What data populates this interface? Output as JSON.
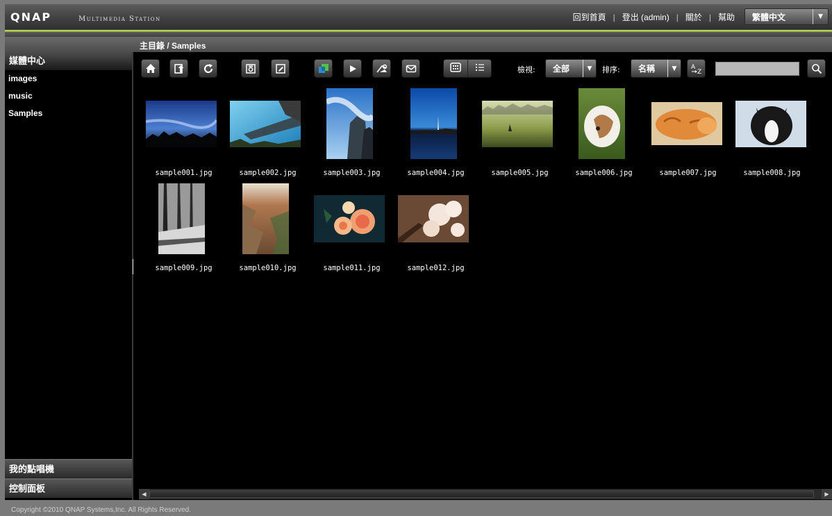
{
  "header": {
    "logo": "QNAP",
    "app_title": "Multimedia Station",
    "links": [
      "回到首頁",
      "登出 (admin)",
      "關於",
      "幫助"
    ],
    "language": "繁體中文"
  },
  "breadcrumb": "主目錄 / Samples",
  "sidebar": {
    "section_title": "媒體中心",
    "items": [
      {
        "label": "images"
      },
      {
        "label": "music"
      },
      {
        "label": "Samples"
      }
    ],
    "bottom_sections": [
      "我的點唱機",
      "控制面板"
    ]
  },
  "toolbar": {
    "buttons": [
      {
        "name": "home-icon"
      },
      {
        "name": "upload-icon"
      },
      {
        "name": "refresh-icon"
      },
      {
        "name": "camera-icon"
      },
      {
        "name": "edit-icon"
      },
      {
        "name": "slideshow-color-icon"
      },
      {
        "name": "play-icon"
      },
      {
        "name": "publish-icon"
      },
      {
        "name": "email-icon"
      }
    ],
    "view_modes": [
      "grid-view-icon",
      "list-view-icon"
    ],
    "view_label": "檢視:",
    "view_value": "全部",
    "sort_label": "排序:",
    "sort_value": "名稱",
    "sort_order_icon": "sort-az-icon",
    "search_placeholder": ""
  },
  "files": [
    {
      "name": "sample001.jpg"
    },
    {
      "name": "sample002.jpg"
    },
    {
      "name": "sample003.jpg"
    },
    {
      "name": "sample004.jpg"
    },
    {
      "name": "sample005.jpg"
    },
    {
      "name": "sample006.jpg"
    },
    {
      "name": "sample007.jpg"
    },
    {
      "name": "sample008.jpg"
    },
    {
      "name": "sample009.jpg"
    },
    {
      "name": "sample010.jpg"
    },
    {
      "name": "sample011.jpg"
    },
    {
      "name": "sample012.jpg"
    }
  ],
  "footer": "Copyright ©2010 QNAP Systems,Inc. All Rights Reserved."
}
